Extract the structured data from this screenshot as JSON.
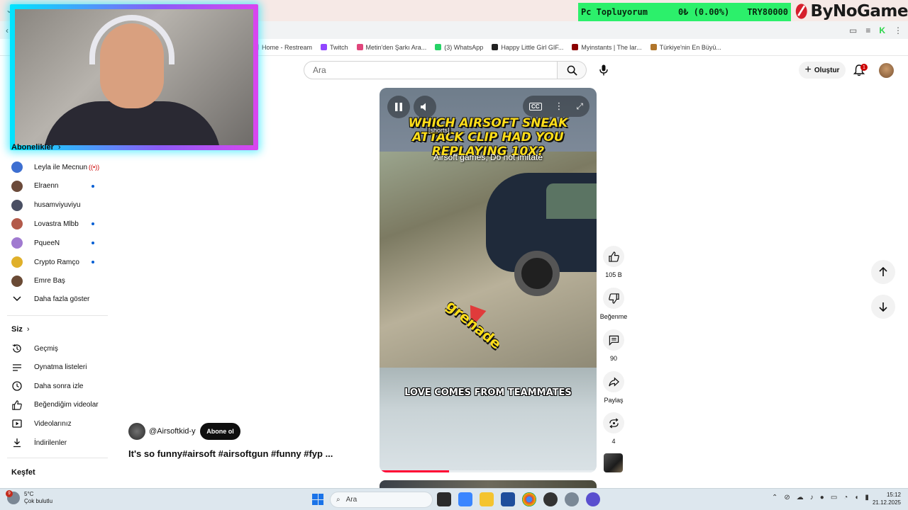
{
  "ticker": {
    "name": "Pc Topluyorum",
    "amount": "0₺ (0.00%)",
    "goal": "TRY80000"
  },
  "brand": {
    "name": "ByNoGame"
  },
  "bookmarks": [
    {
      "label": "Home - Restream",
      "color": "#bbbbbb"
    },
    {
      "label": "Twitch",
      "color": "#9146ff"
    },
    {
      "label": "Metin'den Şarkı Ara...",
      "color": "#e0457b"
    },
    {
      "label": "(3) WhatsApp",
      "color": "#25d366"
    },
    {
      "label": "Happy Little Girl GIF...",
      "color": "#222222"
    },
    {
      "label": "Myinstants | The lar...",
      "color": "#8b0000"
    },
    {
      "label": "Türkiye'nin En Büyü...",
      "color": "#b0752b"
    }
  ],
  "search": {
    "placeholder": "Ara"
  },
  "header": {
    "create_label": "Oluştur",
    "notification_count": "1"
  },
  "sidebar": {
    "subscriptions_label": "Abonelikler",
    "subscriptions": [
      {
        "name": "Leyla ile Mecnun",
        "status": "live",
        "color": "#3d6fd1"
      },
      {
        "name": "Elraenn",
        "status": "new",
        "color": "#6b4a3a"
      },
      {
        "name": "husamviyuviyu",
        "status": "",
        "color": "#4a4f63"
      },
      {
        "name": "Lovastra Mlbb",
        "status": "new",
        "color": "#b35a4a"
      },
      {
        "name": "PqueeN",
        "status": "new",
        "color": "#a07ad0"
      },
      {
        "name": "Crypto Ramço",
        "status": "new",
        "color": "#e0b02a"
      },
      {
        "name": "Emre Baş",
        "status": "",
        "color": "#6a4a35"
      }
    ],
    "show_more_label": "Daha fazla göster",
    "you_label": "Siz",
    "you_items": [
      {
        "label": "Geçmiş",
        "icon": "history-icon"
      },
      {
        "label": "Oynatma listeleri",
        "icon": "playlists-icon"
      },
      {
        "label": "Daha sonra izle",
        "icon": "watch-later-icon"
      },
      {
        "label": "Beğendiğim videolar",
        "icon": "liked-icon"
      },
      {
        "label": "Videolarınız",
        "icon": "your-videos-icon"
      },
      {
        "label": "İndirilenler",
        "icon": "downloads-icon"
      }
    ],
    "explore_label": "Keşfet"
  },
  "short": {
    "headline": "WHICH AIRSOFT SNEAK ATTACK CLIP HAD YOU REPLAYING 10X?",
    "shorts_tag": "[shorts]",
    "caption_top": "Airsoft games, Do not imitate",
    "overlay_word": "grenade",
    "caption_bottom": "LOVE COMES FROM TEAMMATES",
    "progress": 0.32,
    "channel": "@Airsoftkid-y",
    "subscribe_label": "Abone ol",
    "title": "It's so funny#airsoft #airsoftgun #funny #fyp ..."
  },
  "actions": {
    "likes": "105 B",
    "dislike_label": "Beğenme",
    "comments": "90",
    "share_label": "Paylaş",
    "remix_count": "4"
  },
  "taskbar": {
    "weather_temp": "5°C",
    "weather_desc": "Çok bulutlu",
    "weather_badge": "9",
    "search_placeholder": "Ara",
    "time": "15:12",
    "date": "21.12.2025"
  }
}
